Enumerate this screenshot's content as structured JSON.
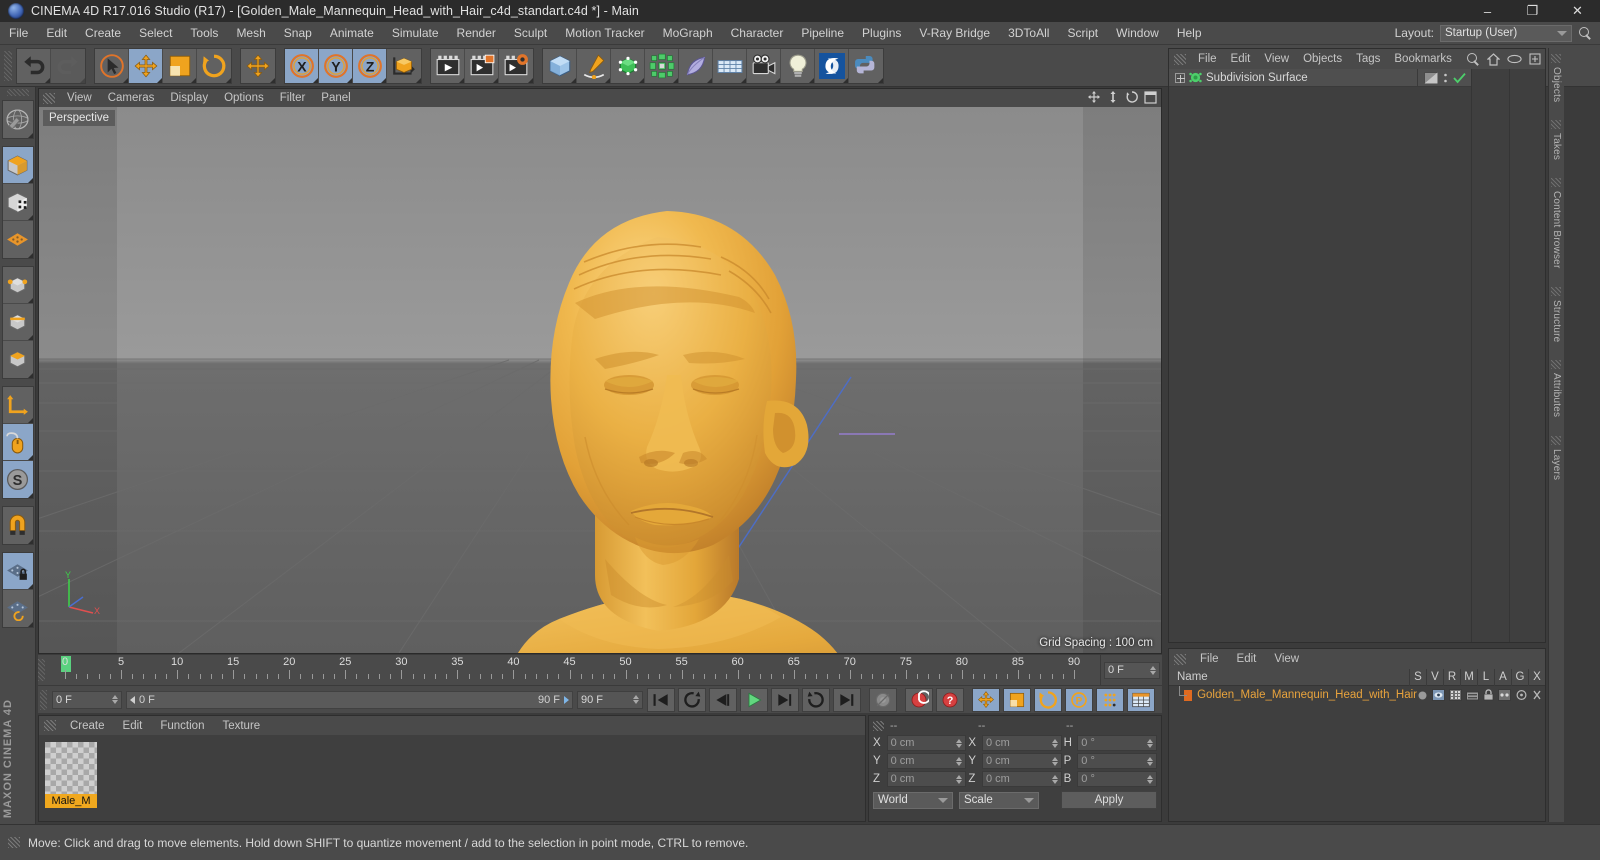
{
  "window": {
    "title": "CINEMA 4D R17.016 Studio (R17) - [Golden_Male_Mannequin_Head_with_Hair_c4d_standart.c4d *] - Main",
    "app_icon": "c4d-logo-icon",
    "minimize": "–",
    "maximize": "❐",
    "close": "✕"
  },
  "menubar": {
    "items": [
      "File",
      "Edit",
      "Create",
      "Select",
      "Tools",
      "Mesh",
      "Snap",
      "Animate",
      "Simulate",
      "Render",
      "Sculpt",
      "Motion Tracker",
      "MoGraph",
      "Character",
      "Pipeline",
      "Plugins",
      "V-Ray Bridge",
      "3DToAll",
      "Script",
      "Window",
      "Help"
    ],
    "layout_label": "Layout:",
    "layout_value": "Startup (User)",
    "search_icon": "search-icon"
  },
  "toolbar": {
    "groups": [
      {
        "name": "history",
        "buttons": [
          {
            "name": "undo-button",
            "icon": "undo-icon",
            "active": false,
            "dim": false
          },
          {
            "name": "redo-button",
            "icon": "redo-icon",
            "active": false,
            "dim": true
          }
        ]
      },
      {
        "name": "transform-tools",
        "buttons": [
          {
            "name": "select-tool",
            "icon": "live-selection-icon",
            "active": false,
            "dim": false
          },
          {
            "name": "move-tool",
            "icon": "move-icon",
            "active": true,
            "dim": false
          },
          {
            "name": "scale-tool",
            "icon": "scale-icon",
            "active": false,
            "dim": false
          },
          {
            "name": "rotate-tool",
            "icon": "rotate-icon",
            "active": false,
            "dim": false
          }
        ]
      },
      {
        "name": "move-alt",
        "buttons": [
          {
            "name": "move-duplicate-tool",
            "icon": "move-icon",
            "active": false,
            "dim": false
          }
        ]
      },
      {
        "name": "axis-locks",
        "buttons": [
          {
            "name": "lock-x-button",
            "icon": "axis-x-icon",
            "active": true,
            "dim": false
          },
          {
            "name": "lock-y-button",
            "icon": "axis-y-icon",
            "active": true,
            "dim": false
          },
          {
            "name": "lock-z-button",
            "icon": "axis-z-icon",
            "active": true,
            "dim": false
          },
          {
            "name": "coordinate-system-button",
            "icon": "world-object-axis-icon",
            "active": false,
            "dim": false
          }
        ]
      },
      {
        "name": "render-tools",
        "buttons": [
          {
            "name": "render-view-button",
            "icon": "render-view-icon",
            "active": false,
            "dim": false
          },
          {
            "name": "render-to-picture-viewer-button",
            "icon": "render-picture-viewer-icon",
            "active": false,
            "dim": false
          },
          {
            "name": "render-settings-button",
            "icon": "render-settings-icon",
            "active": false,
            "dim": false
          }
        ]
      },
      {
        "name": "create-tools",
        "buttons": [
          {
            "name": "add-cube-button",
            "icon": "cube-icon",
            "active": false,
            "dim": false
          },
          {
            "name": "add-spline-button",
            "icon": "pen-spline-icon",
            "active": false,
            "dim": false
          },
          {
            "name": "add-nurbs-button",
            "icon": "generator-icon",
            "active": false,
            "dim": false
          },
          {
            "name": "add-array-button",
            "icon": "array-icon",
            "active": false,
            "dim": false
          },
          {
            "name": "add-bend-deformer-button",
            "icon": "deformer-icon",
            "active": false,
            "dim": false
          },
          {
            "name": "add-floor-button",
            "icon": "environment-floor-icon",
            "active": false,
            "dim": false
          },
          {
            "name": "add-camera-button",
            "icon": "camera-icon",
            "active": false,
            "dim": false
          },
          {
            "name": "add-light-button",
            "icon": "light-bulb-icon",
            "active": false,
            "dim": false
          },
          {
            "name": "content-browser-button",
            "icon": "cinema4d-swirl-icon",
            "active": false,
            "dim": false
          },
          {
            "name": "python-script-button",
            "icon": "python-icon",
            "active": false,
            "dim": false
          }
        ]
      }
    ]
  },
  "left_palette": {
    "groups": [
      {
        "name": "modes",
        "buttons": [
          {
            "name": "make-editable-button",
            "icon": "make-editable-icon",
            "active": false
          }
        ]
      },
      {
        "name": "component-modes",
        "buttons": [
          {
            "name": "model-mode-button",
            "icon": "model-mode-icon",
            "active": true
          },
          {
            "name": "texture-mode-button",
            "icon": "texture-mode-icon",
            "active": false
          },
          {
            "name": "workplane-mode-button",
            "icon": "workplane-icon",
            "active": false
          }
        ]
      },
      {
        "name": "element-modes",
        "buttons": [
          {
            "name": "points-mode-button",
            "icon": "points-mode-icon",
            "active": false
          },
          {
            "name": "edges-mode-button",
            "icon": "edges-mode-icon",
            "active": false
          },
          {
            "name": "polygons-mode-button",
            "icon": "polygons-mode-icon",
            "active": false
          }
        ]
      },
      {
        "name": "axis-tools",
        "buttons": [
          {
            "name": "enable-axis-button",
            "icon": "axis-modify-icon",
            "active": false
          },
          {
            "name": "viewport-solo-button",
            "icon": "mouse-icon",
            "active": true
          },
          {
            "name": "soft-selection-button",
            "icon": "soft-interaction-icon",
            "active": true
          }
        ]
      },
      {
        "name": "snapping",
        "buttons": [
          {
            "name": "enable-snap-button",
            "icon": "magnet-snap-icon",
            "active": false
          }
        ]
      },
      {
        "name": "workplane",
        "buttons": [
          {
            "name": "lock-workplane-button",
            "icon": "workplane-lock-icon",
            "active": true
          },
          {
            "name": "planar-workplane-button",
            "icon": "workplane-rotate-icon",
            "active": false
          }
        ]
      }
    ],
    "brand": "MAXON CINEMA 4D"
  },
  "viewport": {
    "menu": [
      "View",
      "Cameras",
      "Display",
      "Options",
      "Filter",
      "Panel"
    ],
    "camera_label": "Perspective",
    "grid_info": "Grid Spacing : 100 cm",
    "nav_icons": [
      "pan-icon",
      "dolly-icon",
      "rotate-view-icon",
      "maximize-view-icon"
    ],
    "axis_gizmo": {
      "y_label": "Y",
      "x_label": "X"
    },
    "object_color": "#e8a83c"
  },
  "timeline": {
    "labels": [
      "0",
      "5",
      "10",
      "15",
      "20",
      "25",
      "30",
      "35",
      "40",
      "45",
      "50",
      "55",
      "60",
      "65",
      "70",
      "75",
      "80",
      "85",
      "90"
    ],
    "min_frame": 0,
    "max_frame": 90,
    "current_frame_field": "0 F",
    "playhead_frame": 0
  },
  "transport": {
    "current_frame": "0 F",
    "range_start": "0 F",
    "range_end": "90 F",
    "preview_end": "90 F",
    "buttons": [
      {
        "name": "go-to-start-button",
        "icon": "skip-start-icon",
        "active": false
      },
      {
        "name": "previous-key-button",
        "icon": "prev-key-icon",
        "active": false
      },
      {
        "name": "play-backwards-button",
        "icon": "play-back-icon",
        "active": false
      },
      {
        "name": "play-forwards-button",
        "icon": "play-forward-icon",
        "active": false
      },
      {
        "name": "next-frame-button",
        "icon": "next-frame-icon",
        "active": false
      },
      {
        "name": "next-key-button",
        "icon": "next-key-icon",
        "active": false
      },
      {
        "name": "go-to-end-button",
        "icon": "skip-end-icon",
        "active": false
      },
      {
        "name": "record-active-objects-button",
        "icon": "record-disabled-icon",
        "active": false
      },
      {
        "name": "autokeying-button",
        "icon": "autokey-icon",
        "active": false
      },
      {
        "name": "keyframe-selection-button",
        "icon": "keyframe-selection-icon",
        "active": false
      },
      {
        "name": "record-position-button",
        "icon": "position-key-icon",
        "active": true
      },
      {
        "name": "record-scale-button",
        "icon": "scale-key-icon",
        "active": true
      },
      {
        "name": "record-rotation-button",
        "icon": "rotation-key-icon",
        "active": true
      },
      {
        "name": "record-pla-button",
        "icon": "pla-key-icon",
        "active": true
      },
      {
        "name": "record-parameter-button",
        "icon": "parameter-key-icon",
        "active": true
      },
      {
        "name": "timeline-toggle-button",
        "icon": "timeline-icon",
        "active": true
      }
    ]
  },
  "material_manager": {
    "menu": [
      "Create",
      "Edit",
      "Function",
      "Texture"
    ],
    "materials": [
      {
        "name": "Male_M",
        "preview": "gold-sphere-preview",
        "selected": true
      }
    ]
  },
  "coordinates": {
    "headers": [
      "--",
      "--",
      "--"
    ],
    "rows": [
      {
        "label_a": "X",
        "value_a": "0 cm",
        "label_b": "X",
        "value_b": "0 cm",
        "label_c": "H",
        "value_c": "0 °"
      },
      {
        "label_a": "Y",
        "value_a": "0 cm",
        "label_b": "Y",
        "value_b": "0 cm",
        "label_c": "P",
        "value_c": "0 °"
      },
      {
        "label_a": "Z",
        "value_a": "0 cm",
        "label_b": "Z",
        "value_b": "0 cm",
        "label_c": "B",
        "value_c": "0 °"
      }
    ],
    "system": "World",
    "mode": "Scale",
    "apply_label": "Apply"
  },
  "object_manager": {
    "menu": [
      "File",
      "Edit",
      "View",
      "Objects",
      "Tags",
      "Bookmarks"
    ],
    "header_icons": [
      "search-icon",
      "home-icon",
      "eye-icon",
      "expand-icon"
    ],
    "objects": [
      {
        "name": "Subdivision Surface",
        "icon": "subdivision-surface-icon",
        "expandable": true,
        "tags": [
          "display-tag-icon",
          "dots-icon",
          "check-icon"
        ]
      }
    ]
  },
  "attribute_manager": {
    "menu": [
      "File",
      "Edit",
      "View"
    ],
    "columns": [
      "Name",
      "S",
      "V",
      "R",
      "M",
      "L",
      "A",
      "G",
      "X"
    ],
    "rows": [
      {
        "name": "Golden_Male_Mannequin_Head_with_Hair",
        "color": "#e8a33d",
        "swatch": "#e06a20",
        "toggles": [
          "solo-dot",
          "view-icon",
          "render-icon",
          "manager-icon",
          "lock-icon",
          "animation-icon",
          "generator-icon",
          "deformer-icon"
        ]
      }
    ]
  },
  "right_dock": {
    "tabs": [
      "Objects",
      "Takes",
      "Content Browser",
      "Structure",
      "Attributes",
      "Layers"
    ]
  },
  "statusbar": {
    "message": "Move: Click and drag to move elements. Hold down SHIFT to quantize movement / add to the selection in point mode, CTRL to remove."
  }
}
